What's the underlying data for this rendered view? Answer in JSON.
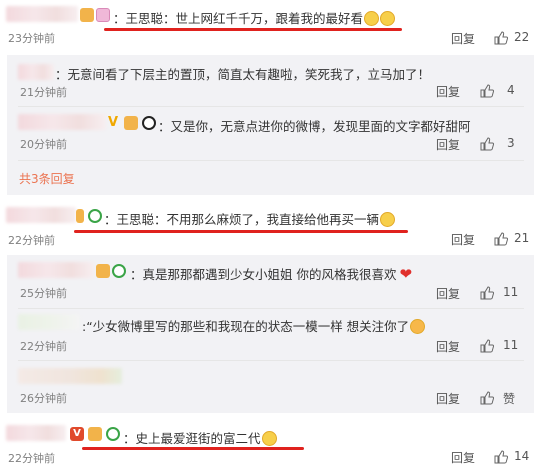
{
  "comments": [
    {
      "text": "：王思聪：世上网红千千万，跟着我的最好看",
      "time": "23分钟前",
      "reply": "回复",
      "likes": "22"
    },
    {
      "text": "：王思聪：不用那么麻烦了，我直接给他再买一辆",
      "time": "22分钟前",
      "reply": "回复",
      "likes": "21"
    },
    {
      "text": "：史上最爱逛街的富二代",
      "time": "22分钟前",
      "reply": "回复",
      "likes": "14"
    }
  ],
  "replies": [
    {
      "text": "：无意间看了下层主的置顶，简直太有趣啦，笑死我了，立马加了！",
      "time": "21分钟前",
      "reply": "回复",
      "likes": "4"
    },
    {
      "text": "：又是你，无意点进你的微博，发现里面的文字都好甜阿",
      "time": "20分钟前",
      "reply": "回复",
      "likes": "3"
    },
    {
      "text": "：真是那那都遇到少女小姐姐 你的风格我很喜欢",
      "time": "25分钟前",
      "reply": "回复",
      "likes": "11"
    },
    {
      "text": ":“少女微博里写的那些和我现在的状态一模一样 想关注你了",
      "time": "22分钟前",
      "reply": "回复",
      "likes": "11"
    },
    {
      "text": "",
      "time": "26分钟前",
      "reply": "回复",
      "likes": "赞"
    }
  ],
  "more_replies": "共3条回复",
  "icons": {
    "like": "thumbs-up-icon",
    "emoji": "emoji-icon",
    "verified": "verified-icon"
  },
  "colors": {
    "accent": "#eb7350",
    "underline": "#e0221e",
    "reply_bg": "#f2f2f5"
  }
}
